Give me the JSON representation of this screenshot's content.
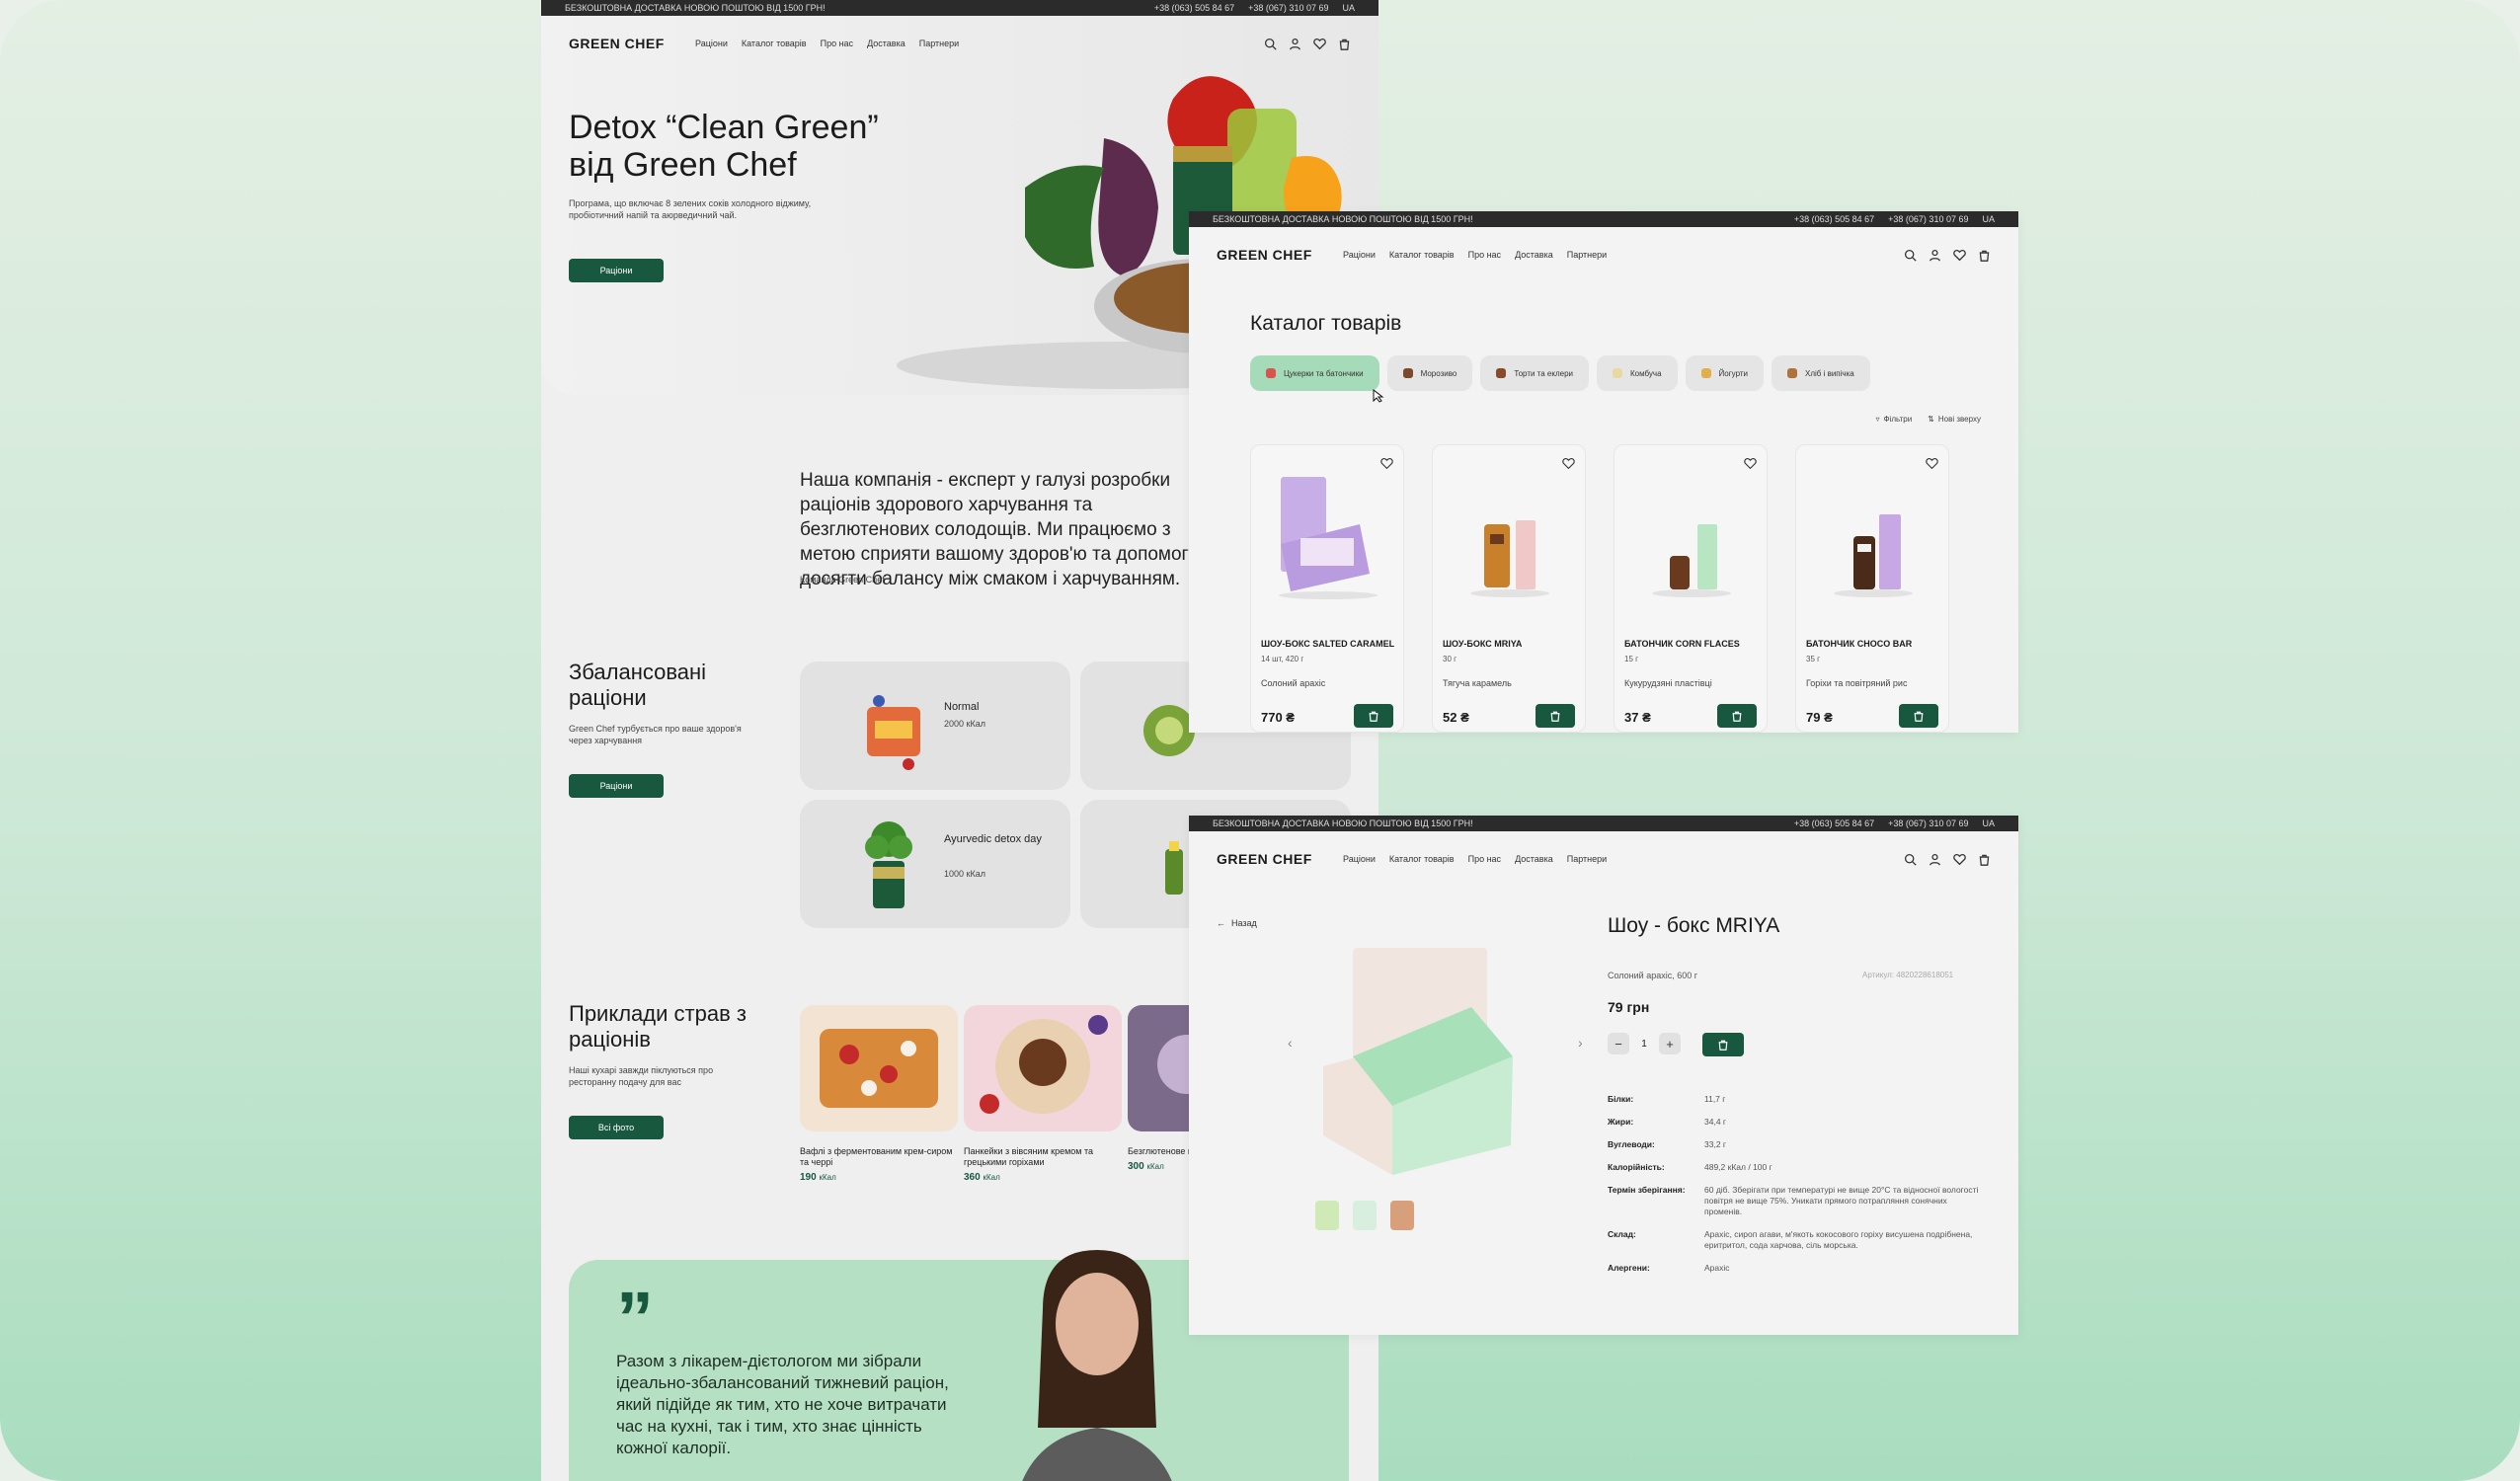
{
  "topbar": {
    "shipping": "БЕЗКОШТОВНА ДОСТАВКА НОВОЮ ПОШТОЮ ВІД 1500 ГРН!",
    "phone1": "+38 (063) 505 84 67",
    "phone2": "+38 (067) 310 07 69",
    "lang": "UA"
  },
  "nav": {
    "logo": "GREEN CHEF",
    "links": [
      "Раціони",
      "Каталог товарів",
      "Про нас",
      "Доставка",
      "Партнери"
    ]
  },
  "home": {
    "hero_title": "Detox “Clean Green” від Green Chef",
    "hero_sub": "Програма, що включає 8 зелених соків холодного віджиму, пробіотичний напій та аюрведичний чай.",
    "hero_button": "Раціони",
    "about_text": "Наша компанія - експерт у галузі розробки раціонів здорового харчування та безглютенових солодощів. Ми працюємо з метою сприяти вашому здоров'ю та допомогти досягти балансу між смаком і харчуванням.",
    "about_sign": "Команда Green Chef",
    "diets_title": "Збалансовані раціони",
    "diets_sub": "Green Chef турбується про ваше здоров'я через харчування",
    "diets_button": "Раціони",
    "diets": [
      {
        "name": "Normal",
        "kcal": "2000 кКал"
      },
      {
        "name": "Ayurvedic detox day",
        "kcal": "1000 кКал"
      }
    ],
    "dishes_title": "Приклади страв з раціонів",
    "dishes_sub": "Наші кухарі завжди піклуються про ресторанну подачу для вас",
    "dishes_button": "Всі фото",
    "dishes": [
      {
        "name": "Вафлі з ферментованим крем-сиром та черрі",
        "kcal": "190",
        "unit": "кКал"
      },
      {
        "name": "Панкейки з вівсяним кремом та грецькими горіхами",
        "kcal": "360",
        "unit": "кКал"
      },
      {
        "name": "Безглютенове шийтаке та гр",
        "kcal": "300",
        "unit": "кКал"
      }
    ],
    "quote": "Разом з лікарем-дієтологом ми зібрали ідеально-збалансований тижневий раціон, який підійде як тим, хто не хоче витрачати час на кухні, так і тим, хто знає цінність кожної калорії."
  },
  "catalog": {
    "title": "Каталог товарів",
    "chips": [
      {
        "label": "Цукерки та батончики",
        "active": true,
        "color": "#d9534f"
      },
      {
        "label": "Морозиво",
        "active": false,
        "color": "#7a4a2a"
      },
      {
        "label": "Торти та еклери",
        "active": false,
        "color": "#8a4b2b"
      },
      {
        "label": "Комбуча",
        "active": false,
        "color": "#e7d9a0"
      },
      {
        "label": "Йогурти",
        "active": false,
        "color": "#e2b04a"
      },
      {
        "label": "Хліб і випічка",
        "active": false,
        "color": "#b0713a"
      }
    ],
    "filters": "Фільтри",
    "sort": "Нові зверху",
    "products": [
      {
        "name": "ШОУ-БОКС SALTED CARAMEL",
        "weight": "14 шт, 420 г",
        "desc": "Солоний арахіс",
        "price": "770 ₴"
      },
      {
        "name": "ШОУ-БОКС MRIYA",
        "weight": "30 г",
        "desc": "Тягуча карамель",
        "price": "52 ₴"
      },
      {
        "name": "БАТОНЧИК CORN FLACES",
        "weight": "15 г",
        "desc": "Кукурудзяні пластівці",
        "price": "37 ₴"
      },
      {
        "name": "БАТОНЧИК CHOCO BAR",
        "weight": "35 г",
        "desc": "Горіхи та повітряний рис",
        "price": "79 ₴"
      }
    ]
  },
  "detail": {
    "back": "Назад",
    "title": "Шоу - бокс MRIYA",
    "subtitle": "Солоний арахіс, 600 г",
    "article": "Артикул: 4820228618051",
    "price": "79 грн",
    "qty": "1",
    "specs": [
      {
        "label": "Білки:",
        "value": "11,7 г"
      },
      {
        "label": "Жири:",
        "value": "34,4 г"
      },
      {
        "label": "Вуглеводи:",
        "value": "33,2 г"
      },
      {
        "label": "Калорійність:",
        "value": "489,2 кКал / 100 г"
      },
      {
        "label": "Термін зберігання:",
        "value": "60 діб. Зберігати при температурі не вище 20°С та відносної вологості повітря не вище 75%. Уникати прямого потрапляння сонячних променів."
      },
      {
        "label": "Склад:",
        "value": "Арахіс, сироп агави, м'якоть кокосового горіху висушена подрібнена, еритритол, сода харчова, сіль морська."
      },
      {
        "label": "Алергени:",
        "value": "Арахіс"
      }
    ]
  },
  "colors": {
    "accent": "#17583f",
    "chip_active": "#a6dbb9",
    "mint": "#b5e0c4"
  }
}
